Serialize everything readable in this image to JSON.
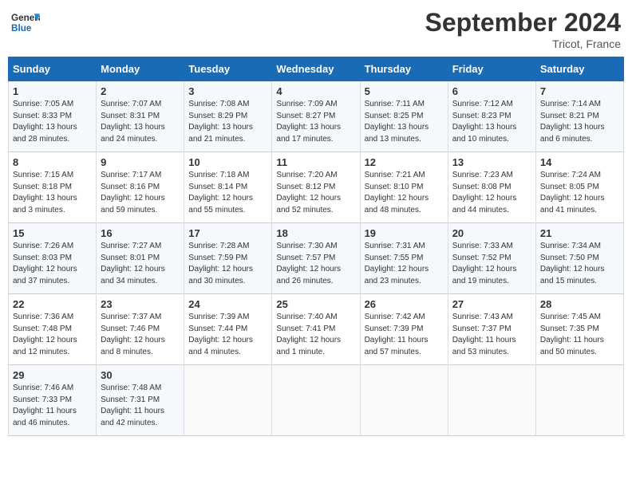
{
  "header": {
    "title": "September 2024",
    "location": "Tricot, France",
    "logo_general": "General",
    "logo_blue": "Blue"
  },
  "days_of_week": [
    "Sunday",
    "Monday",
    "Tuesday",
    "Wednesday",
    "Thursday",
    "Friday",
    "Saturday"
  ],
  "weeks": [
    [
      {
        "day": "1",
        "info": "Sunrise: 7:05 AM\nSunset: 8:33 PM\nDaylight: 13 hours\nand 28 minutes."
      },
      {
        "day": "2",
        "info": "Sunrise: 7:07 AM\nSunset: 8:31 PM\nDaylight: 13 hours\nand 24 minutes."
      },
      {
        "day": "3",
        "info": "Sunrise: 7:08 AM\nSunset: 8:29 PM\nDaylight: 13 hours\nand 21 minutes."
      },
      {
        "day": "4",
        "info": "Sunrise: 7:09 AM\nSunset: 8:27 PM\nDaylight: 13 hours\nand 17 minutes."
      },
      {
        "day": "5",
        "info": "Sunrise: 7:11 AM\nSunset: 8:25 PM\nDaylight: 13 hours\nand 13 minutes."
      },
      {
        "day": "6",
        "info": "Sunrise: 7:12 AM\nSunset: 8:23 PM\nDaylight: 13 hours\nand 10 minutes."
      },
      {
        "day": "7",
        "info": "Sunrise: 7:14 AM\nSunset: 8:21 PM\nDaylight: 13 hours\nand 6 minutes."
      }
    ],
    [
      {
        "day": "8",
        "info": "Sunrise: 7:15 AM\nSunset: 8:18 PM\nDaylight: 13 hours\nand 3 minutes."
      },
      {
        "day": "9",
        "info": "Sunrise: 7:17 AM\nSunset: 8:16 PM\nDaylight: 12 hours\nand 59 minutes."
      },
      {
        "day": "10",
        "info": "Sunrise: 7:18 AM\nSunset: 8:14 PM\nDaylight: 12 hours\nand 55 minutes."
      },
      {
        "day": "11",
        "info": "Sunrise: 7:20 AM\nSunset: 8:12 PM\nDaylight: 12 hours\nand 52 minutes."
      },
      {
        "day": "12",
        "info": "Sunrise: 7:21 AM\nSunset: 8:10 PM\nDaylight: 12 hours\nand 48 minutes."
      },
      {
        "day": "13",
        "info": "Sunrise: 7:23 AM\nSunset: 8:08 PM\nDaylight: 12 hours\nand 44 minutes."
      },
      {
        "day": "14",
        "info": "Sunrise: 7:24 AM\nSunset: 8:05 PM\nDaylight: 12 hours\nand 41 minutes."
      }
    ],
    [
      {
        "day": "15",
        "info": "Sunrise: 7:26 AM\nSunset: 8:03 PM\nDaylight: 12 hours\nand 37 minutes."
      },
      {
        "day": "16",
        "info": "Sunrise: 7:27 AM\nSunset: 8:01 PM\nDaylight: 12 hours\nand 34 minutes."
      },
      {
        "day": "17",
        "info": "Sunrise: 7:28 AM\nSunset: 7:59 PM\nDaylight: 12 hours\nand 30 minutes."
      },
      {
        "day": "18",
        "info": "Sunrise: 7:30 AM\nSunset: 7:57 PM\nDaylight: 12 hours\nand 26 minutes."
      },
      {
        "day": "19",
        "info": "Sunrise: 7:31 AM\nSunset: 7:55 PM\nDaylight: 12 hours\nand 23 minutes."
      },
      {
        "day": "20",
        "info": "Sunrise: 7:33 AM\nSunset: 7:52 PM\nDaylight: 12 hours\nand 19 minutes."
      },
      {
        "day": "21",
        "info": "Sunrise: 7:34 AM\nSunset: 7:50 PM\nDaylight: 12 hours\nand 15 minutes."
      }
    ],
    [
      {
        "day": "22",
        "info": "Sunrise: 7:36 AM\nSunset: 7:48 PM\nDaylight: 12 hours\nand 12 minutes."
      },
      {
        "day": "23",
        "info": "Sunrise: 7:37 AM\nSunset: 7:46 PM\nDaylight: 12 hours\nand 8 minutes."
      },
      {
        "day": "24",
        "info": "Sunrise: 7:39 AM\nSunset: 7:44 PM\nDaylight: 12 hours\nand 4 minutes."
      },
      {
        "day": "25",
        "info": "Sunrise: 7:40 AM\nSunset: 7:41 PM\nDaylight: 12 hours\nand 1 minute."
      },
      {
        "day": "26",
        "info": "Sunrise: 7:42 AM\nSunset: 7:39 PM\nDaylight: 11 hours\nand 57 minutes."
      },
      {
        "day": "27",
        "info": "Sunrise: 7:43 AM\nSunset: 7:37 PM\nDaylight: 11 hours\nand 53 minutes."
      },
      {
        "day": "28",
        "info": "Sunrise: 7:45 AM\nSunset: 7:35 PM\nDaylight: 11 hours\nand 50 minutes."
      }
    ],
    [
      {
        "day": "29",
        "info": "Sunrise: 7:46 AM\nSunset: 7:33 PM\nDaylight: 11 hours\nand 46 minutes."
      },
      {
        "day": "30",
        "info": "Sunrise: 7:48 AM\nSunset: 7:31 PM\nDaylight: 11 hours\nand 42 minutes."
      },
      {
        "day": "",
        "info": ""
      },
      {
        "day": "",
        "info": ""
      },
      {
        "day": "",
        "info": ""
      },
      {
        "day": "",
        "info": ""
      },
      {
        "day": "",
        "info": ""
      }
    ]
  ]
}
